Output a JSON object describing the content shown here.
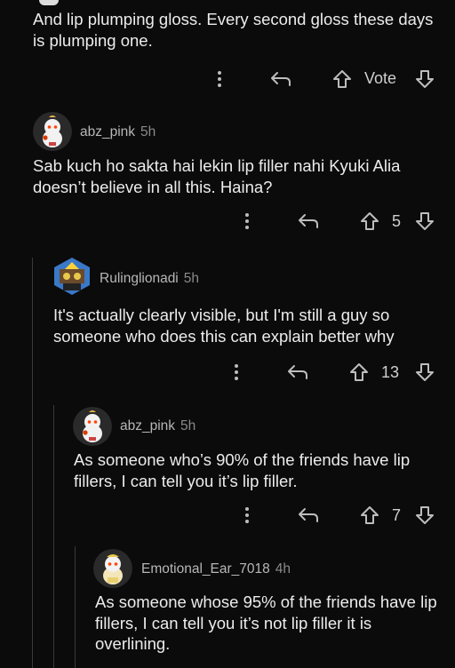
{
  "comments": [
    {
      "text": "And lip plumping gloss. Every second gloss these days is plumping one.",
      "vote_label": "Vote"
    },
    {
      "username": "abz_pink",
      "time": "5h",
      "text": "Sab kuch ho sakta hai lekin lip filler nahi Kyuki Alia doesn’t believe in all this. Haina?",
      "score": "5"
    },
    {
      "username": "Rulinglionadi",
      "time": "5h",
      "text": "It's actually clearly visible, but I'm still a guy so someone who does this can explain better why",
      "score": "13"
    },
    {
      "username": "abz_pink",
      "time": "5h",
      "text": "As someone who’s 90% of the friends have lip fillers, I can tell you it’s lip filler.",
      "score": "7"
    },
    {
      "username": "Emotional_Ear_7018",
      "time": "4h",
      "text": "As someone whose 95% of the friends have lip fillers, I can tell you it’s not lip filler it is overlining."
    }
  ],
  "icons": {
    "more": "more-vertical-icon",
    "reply": "reply-arrow-icon",
    "upvote": "upvote-arrow-icon",
    "downvote": "downvote-arrow-icon"
  },
  "colors": {
    "background": "#0b0b0b",
    "text": "#ececec",
    "muted": "#b7b7b7",
    "thread_line": "#3a3a3a"
  }
}
